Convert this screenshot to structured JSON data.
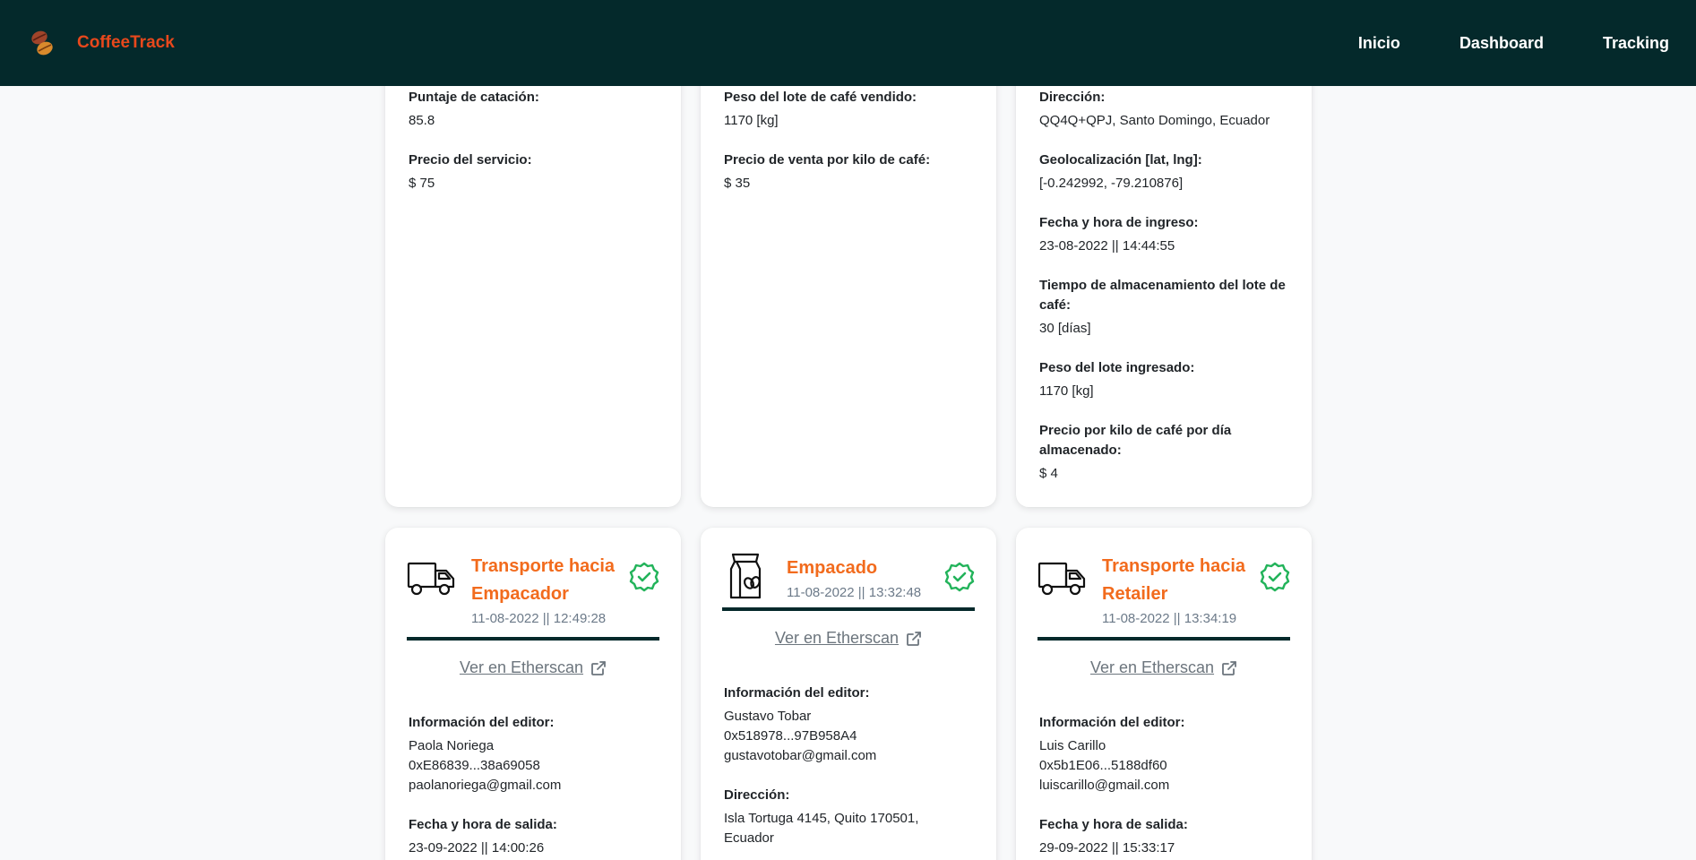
{
  "navbar": {
    "brand": "CoffeeTrack",
    "links": [
      "Inicio",
      "Dashboard",
      "Tracking"
    ]
  },
  "top_cards": [
    {
      "fields": [
        {
          "label": "Puntaje de catación:",
          "value": "85.8"
        },
        {
          "label": "Precio del servicio:",
          "value": "$ 75"
        }
      ]
    },
    {
      "fields": [
        {
          "label": "Peso del lote de café vendido:",
          "value": "1170 [kg]"
        },
        {
          "label": "Precio de venta por kilo de café:",
          "value": "$ 35"
        }
      ]
    },
    {
      "fields": [
        {
          "label": "Dirección:",
          "value": "QQ4Q+QPJ, Santo Domingo, Ecuador"
        },
        {
          "label": "Geolocalización [lat, lng]:",
          "value": "[-0.242992, -79.210876]"
        },
        {
          "label": "Fecha y hora de ingreso:",
          "value": "23-08-2022 || 14:44:55"
        },
        {
          "label": "Tiempo de almacenamiento del lote de café:",
          "value": "30 [días]"
        },
        {
          "label": "Peso del lote ingresado:",
          "value": "1170 [kg]"
        },
        {
          "label": "Precio por kilo de café por día almacenado:",
          "value": "$ 4"
        }
      ]
    }
  ],
  "bottom_cards": [
    {
      "icon": "truck-icon",
      "title_line1": "Transporte hacia",
      "title_line2": "Empacador",
      "date": "11-08-2022 || 12:49:28",
      "etherscan": "Ver en Etherscan",
      "editor_label": "Información del editor:",
      "editor_name": "Paola Noriega",
      "editor_address": "0xE86839...38a69058",
      "editor_email": "paolanoriega@gmail.com",
      "extra_label": "Fecha y hora de salida:",
      "extra_value": "23-09-2022 || 14:00:26"
    },
    {
      "icon": "coffee-bag-icon",
      "title_line1": "Empacado",
      "title_line2": "",
      "date": "11-08-2022 || 13:32:48",
      "etherscan": "Ver en Etherscan",
      "editor_label": "Información del editor:",
      "editor_name": "Gustavo Tobar",
      "editor_address": "0x518978...97B958A4",
      "editor_email": "gustavotobar@gmail.com",
      "extra_label": "Dirección:",
      "extra_value_line1": "Isla Tortuga 4145, Quito 170501,",
      "extra_value_line2": "Ecuador"
    },
    {
      "icon": "truck-icon",
      "title_line1": "Transporte hacia",
      "title_line2": "Retailer",
      "date": "11-08-2022 || 13:34:19",
      "etherscan": "Ver en Etherscan",
      "editor_label": "Información del editor:",
      "editor_name": "Luis Carillo",
      "editor_address": "0x5b1E06...5188df60",
      "editor_email": "luiscarillo@gmail.com",
      "extra_label": "Fecha y hora de salida:",
      "extra_value": "29-09-2022 || 15:33:17"
    }
  ],
  "colors": {
    "navbar_bg": "#04292b",
    "brand": "#e8481c",
    "stage_title": "#f26b1d",
    "verified_check": "#22b35a"
  }
}
